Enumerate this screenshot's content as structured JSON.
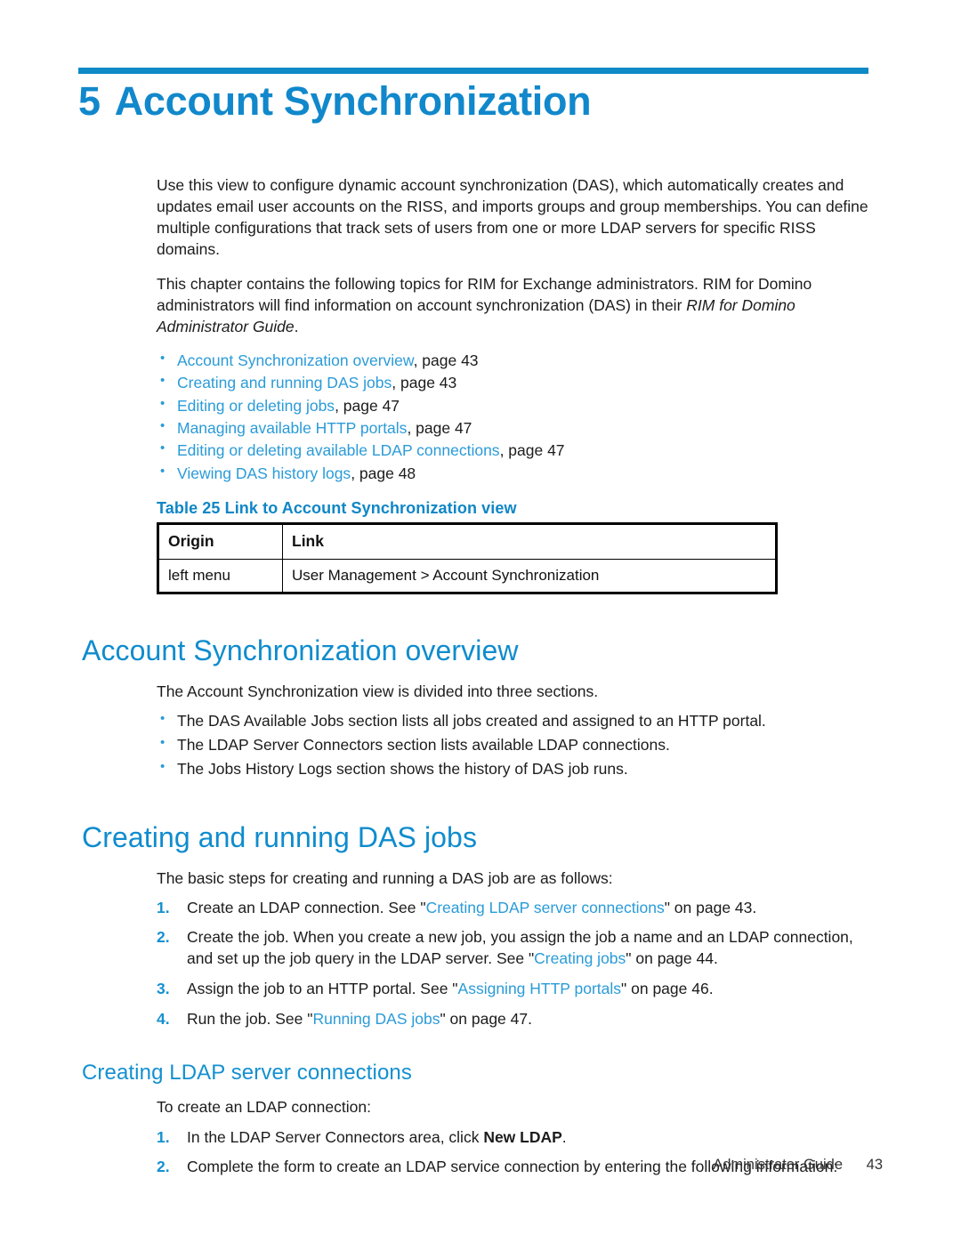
{
  "chapter": {
    "number": "5",
    "title": "Account Synchronization"
  },
  "intro": {
    "paragraph_1": "Use this view to configure dynamic account synchronization (DAS), which automatically creates and updates email user accounts on the RISS, and imports groups and group memberships. You can define multiple configurations that track sets of users from one or more LDAP servers for specific RISS domains.",
    "paragraph_2_part1": "This chapter contains the following topics for RIM for Exchange administrators. RIM for Domino administrators will find information on account synchronization (DAS) in their ",
    "paragraph_2_italic": "RIM for Domino Administrator Guide",
    "paragraph_2_part2": "."
  },
  "toc": {
    "items": [
      {
        "link": "Account Synchronization overview",
        "suffix": ", page 43"
      },
      {
        "link": "Creating and running DAS jobs",
        "suffix": ", page 43"
      },
      {
        "link": "Editing or deleting jobs",
        "suffix": ", page 47"
      },
      {
        "link": "Managing available HTTP portals",
        "suffix": ", page 47"
      },
      {
        "link": "Editing or deleting available LDAP connections",
        "suffix": ", page 47"
      },
      {
        "link": "Viewing DAS history logs",
        "suffix": ", page 48"
      }
    ]
  },
  "table": {
    "caption": "Table 25 Link to Account Synchronization view",
    "headers": [
      "Origin",
      "Link"
    ],
    "rows": [
      [
        "left menu",
        "User Management > Account Synchronization"
      ]
    ]
  },
  "overview": {
    "heading": "Account Synchronization overview",
    "intro": "The Account Synchronization view is divided into three sections.",
    "bullets": [
      "The DAS Available Jobs section lists all jobs created and assigned to an HTTP portal.",
      "The LDAP Server Connectors section lists available LDAP connections.",
      "The Jobs History Logs section shows the history of DAS job runs."
    ]
  },
  "creating_das_jobs": {
    "heading": "Creating and running DAS jobs",
    "intro": "The basic steps for creating and running a DAS job are as follows:",
    "steps": [
      {
        "num": "1.",
        "before": "Create an LDAP connection. See \"",
        "xref": "Creating LDAP server connections",
        "after": "\" on page 43."
      },
      {
        "num": "2.",
        "before": "Create the job. When you create a new job, you assign the job a name and an LDAP connection, and set up the job query in the LDAP server. See \"",
        "xref": "Creating jobs",
        "after": "\" on page 44."
      },
      {
        "num": "3.",
        "before": "Assign the job to an HTTP portal. See \"",
        "xref": "Assigning HTTP portals",
        "after": "\" on page 46."
      },
      {
        "num": "4.",
        "before": "Run the job. See \"",
        "xref": "Running DAS jobs",
        "after": "\" on page 47."
      }
    ]
  },
  "creating_ldap": {
    "heading": "Creating LDAP server connections",
    "intro": "To create an LDAP connection:",
    "steps": [
      {
        "num": "1.",
        "before": "In the LDAP Server Connectors area, click ",
        "bold": "New LDAP",
        "after": "."
      },
      {
        "num": "2.",
        "before": "Complete the form to create an LDAP service connection by entering the following information:",
        "bold": "",
        "after": ""
      }
    ]
  },
  "footer": {
    "guide_label": "Administrator Guide",
    "page_number": "43"
  },
  "colors": {
    "accent_blue": "#0e8ac6",
    "heading_blue": "#0f8ccd",
    "link_blue": "#2a9bd8",
    "text_black": "#1c1c1c"
  }
}
